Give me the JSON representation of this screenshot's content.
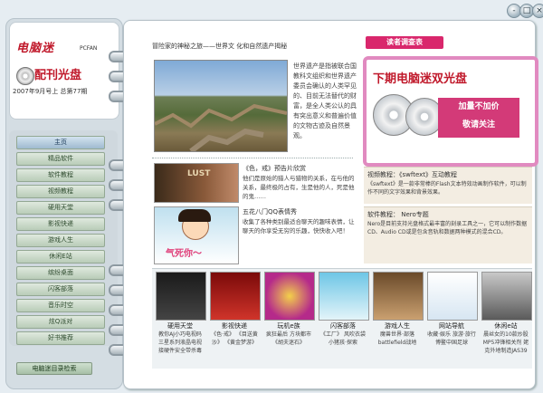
{
  "window": {
    "buttons": [
      "-",
      "□",
      "×"
    ]
  },
  "logo": {
    "brand": "电脑迷",
    "brand_en": "PCFAN",
    "title": "配刊光盘",
    "issue": "2007年9月号上  总第77期"
  },
  "nav": [
    "主页",
    "精品软件",
    "软件教程",
    "视频教程",
    "硬用天堂",
    "影视快递",
    "游戏人生",
    "休闲E站",
    "缤纷桌面",
    "闪客部落",
    "音乐时空",
    "炫Q派对",
    "好书推荐"
  ],
  "bottom_button": "电脑迷目录检索",
  "feature": {
    "title": "冒险家的神秘之旅——世界文 化和自然遗产揭秘",
    "text": "世界遗产是指被联合国教科文组织和世界遗产委员会确认的人类罕见的、目前无法替代的财富，是全人类公认的具有突出意义和普遍价值的文物古迹及自然景观。"
  },
  "story1": {
    "title": "《色，戒》预告片欣赏",
    "text": "他们是原始的猎人与猎物的关系，在与他的关系，最终极的占有，生是他的人，死是他的鬼……"
  },
  "story2": {
    "title": "五花八门QQ表情秀",
    "text": "收集了各种类别最适合聊天的趣味表情，让聊天的你享受无穷的乐趣，快快收入吧！",
    "image_caption": "气死你～"
  },
  "survey_tag": "读者调查表",
  "promo": {
    "headline": "下期电脑迷双光盘",
    "line1": "加量不加价",
    "line2": "敬请关注"
  },
  "video": {
    "title": "视频教程：《swftext》互动教程",
    "text": "《swftext》是一款非常棒的Flash文本特效动画制作软件，可以制作不同的文字效果和背景效果。"
  },
  "software": {
    "title": "软件教程： Nero专题",
    "text": "Nero是目前支持光盘格式最丰富的刻录工具之一，它可以制作数据CD、Audio CD或是包含音轨和数据两种模式的混合CD。"
  },
  "strip": [
    {
      "label": "硬用天堂",
      "text": "教你AJ小巧电视码 三星系列液晶电视 接硬件安全带杀毒"
    },
    {
      "label": "影视快递",
      "text": "《色·戒》 《目送黄沙》 《黄金梦游》"
    },
    {
      "label": "玩机e族",
      "text": "疯狂最后 方块都市 《胡夫迷石》"
    },
    {
      "label": "闪客部落",
      "text": "《工厂》 风吹衣袋 小猪孩·探索"
    },
    {
      "label": "游戏人生",
      "text": "魔兽世界·部落 battlefield战地"
    },
    {
      "label": "网站导航",
      "text": "收藏·娱乐 旅游·旅行 博鳌中国足球"
    },
    {
      "label": "休闲e站",
      "text": "晨丝女的10款炒股 MP5冲锋相关剂 姥克外地制造JAS39"
    }
  ],
  "colors": {
    "brand": "#c0182a",
    "pink": "#d9276c",
    "nav_green": "#b9ccb8"
  }
}
